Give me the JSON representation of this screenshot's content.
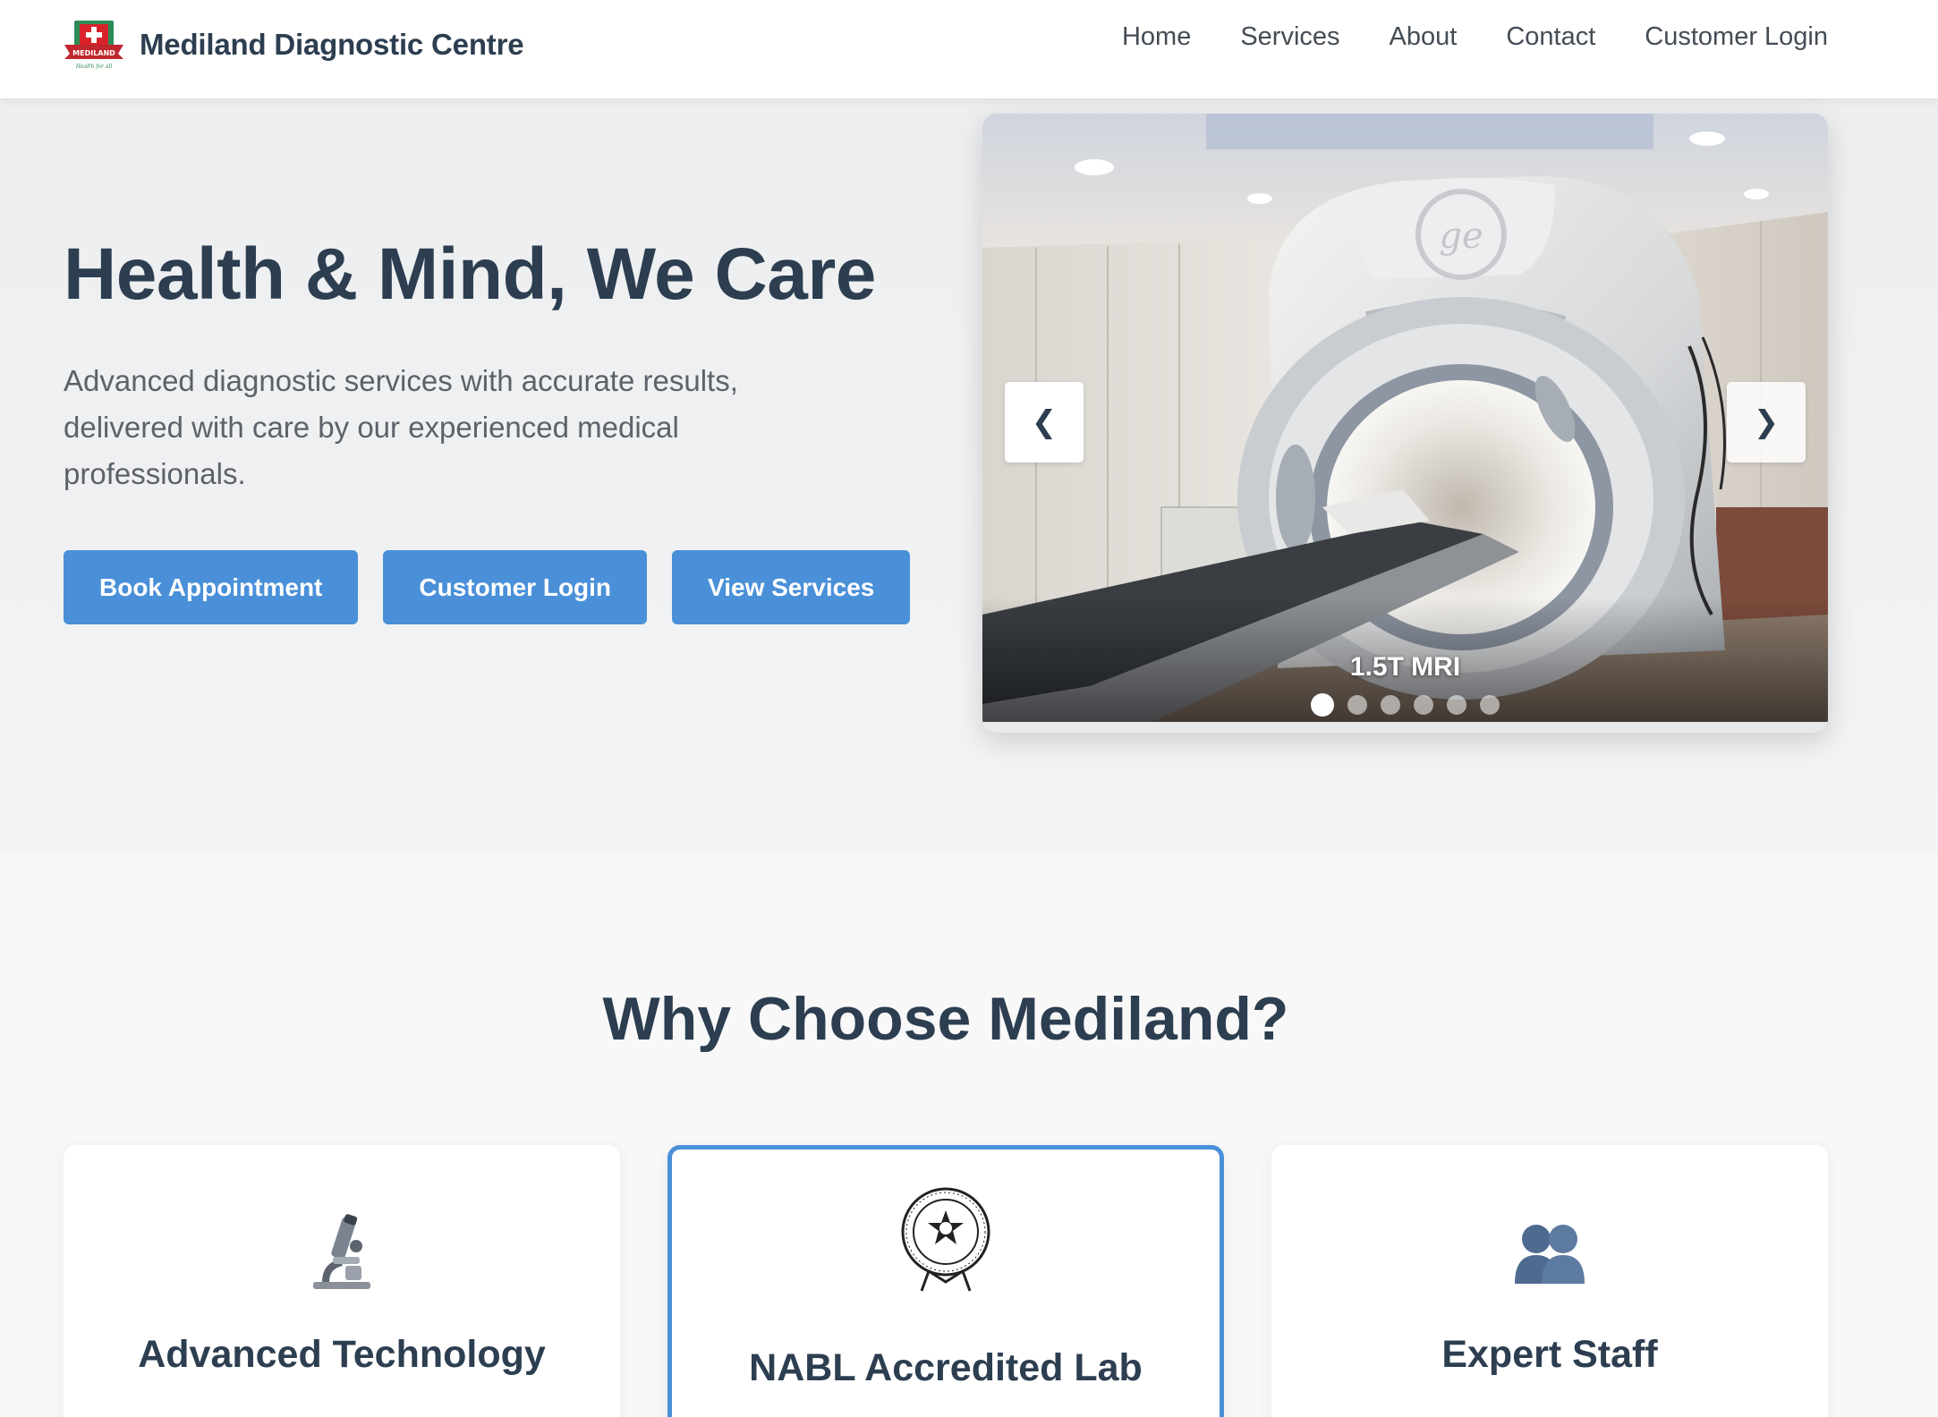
{
  "header": {
    "brand_name": "Mediland Diagnostic Centre",
    "logo_badge": "MEDILAND",
    "logo_tagline": "Health for all"
  },
  "nav": {
    "items": [
      {
        "label": "Home"
      },
      {
        "label": "Services"
      },
      {
        "label": "About"
      },
      {
        "label": "Contact"
      },
      {
        "label": "Customer Login"
      }
    ]
  },
  "hero": {
    "title": "Health & Mind, We Care",
    "subtitle": "Advanced diagnostic services with accurate results, delivered with care by our experienced medical professionals.",
    "buttons": [
      {
        "label": "Book Appointment"
      },
      {
        "label": "Customer Login"
      },
      {
        "label": "View Services"
      }
    ]
  },
  "carousel": {
    "caption": "1.5T MRI",
    "prev_label": "❮",
    "next_label": "❯",
    "slide_count": 6,
    "active_index": 0
  },
  "why": {
    "title": "Why Choose Mediland?",
    "cards": [
      {
        "title": "Advanced Technology",
        "icon": "microscope-icon"
      },
      {
        "title": "NABL Accredited Lab",
        "icon": "nabl-seal-icon"
      },
      {
        "title": "Expert Staff",
        "icon": "people-icon"
      }
    ]
  },
  "colors": {
    "accent": "#4a90d9",
    "heading": "#2c3e50",
    "hero_bg": "#eff0f2",
    "page_bg": "#f8f8f8"
  }
}
